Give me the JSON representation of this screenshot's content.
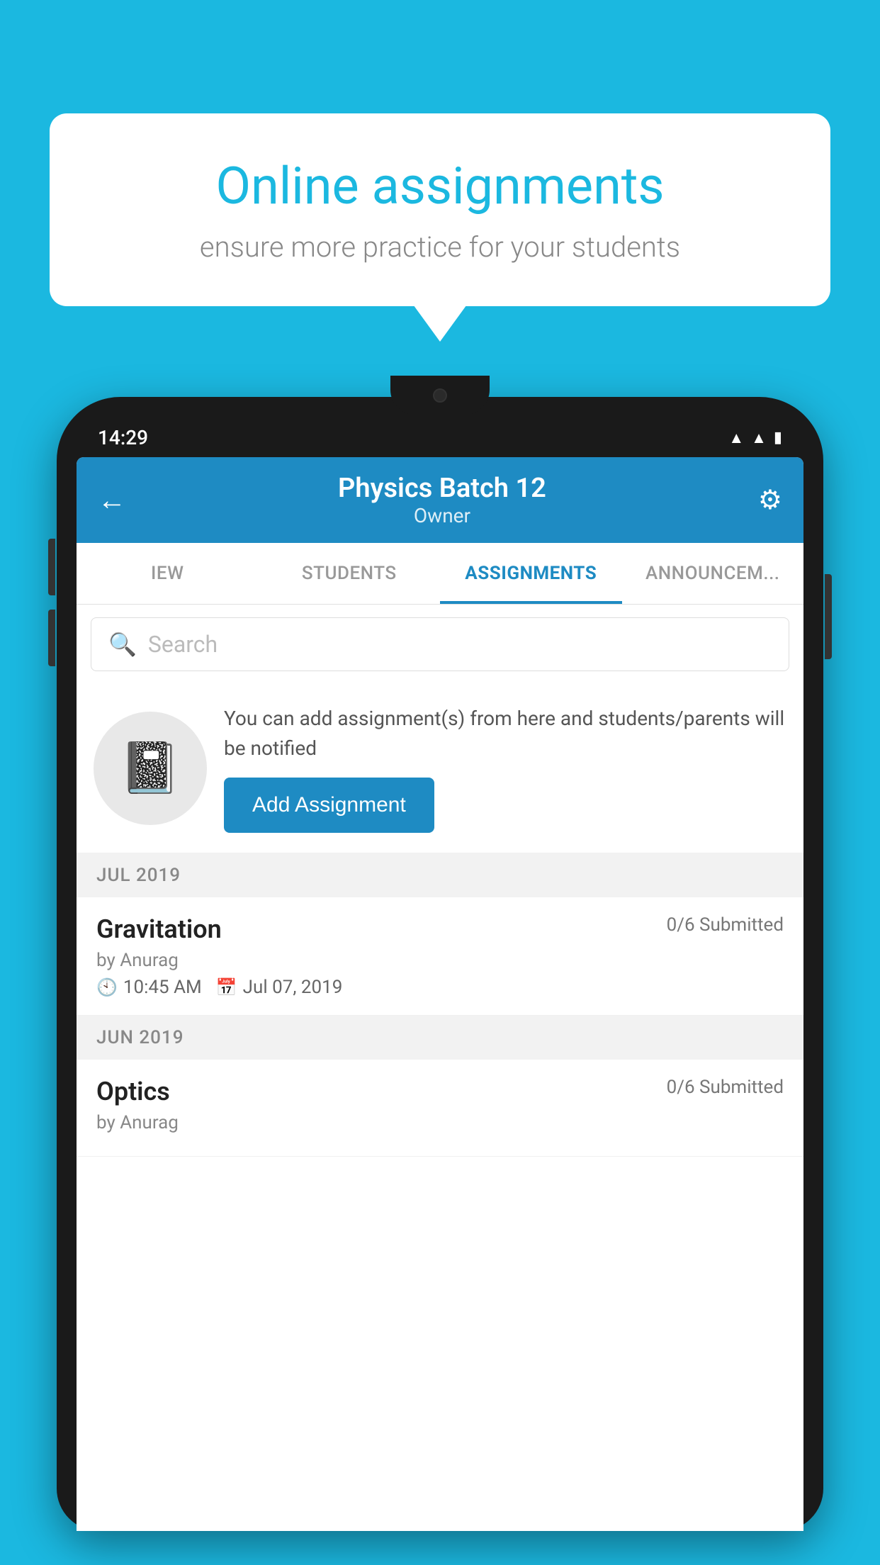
{
  "background_color": "#1BB8E0",
  "speech_bubble": {
    "title": "Online assignments",
    "subtitle": "ensure more practice for your students"
  },
  "status_bar": {
    "time": "14:29",
    "icons": [
      "wifi",
      "signal",
      "battery"
    ]
  },
  "header": {
    "title": "Physics Batch 12",
    "subtitle": "Owner",
    "back_label": "←",
    "settings_label": "⚙"
  },
  "tabs": [
    {
      "label": "IEW",
      "active": false
    },
    {
      "label": "STUDENTS",
      "active": false
    },
    {
      "label": "ASSIGNMENTS",
      "active": true
    },
    {
      "label": "ANNOUNCEM...",
      "active": false
    }
  ],
  "search": {
    "placeholder": "Search"
  },
  "info_card": {
    "description": "You can add assignment(s) from here and students/parents will be notified",
    "button_label": "Add Assignment"
  },
  "sections": [
    {
      "month": "JUL 2019",
      "assignments": [
        {
          "name": "Gravitation",
          "submitted": "0/6 Submitted",
          "author": "by Anurag",
          "time": "10:45 AM",
          "date": "Jul 07, 2019"
        }
      ]
    },
    {
      "month": "JUN 2019",
      "assignments": [
        {
          "name": "Optics",
          "submitted": "0/6 Submitted",
          "author": "by Anurag",
          "time": "",
          "date": ""
        }
      ]
    }
  ]
}
